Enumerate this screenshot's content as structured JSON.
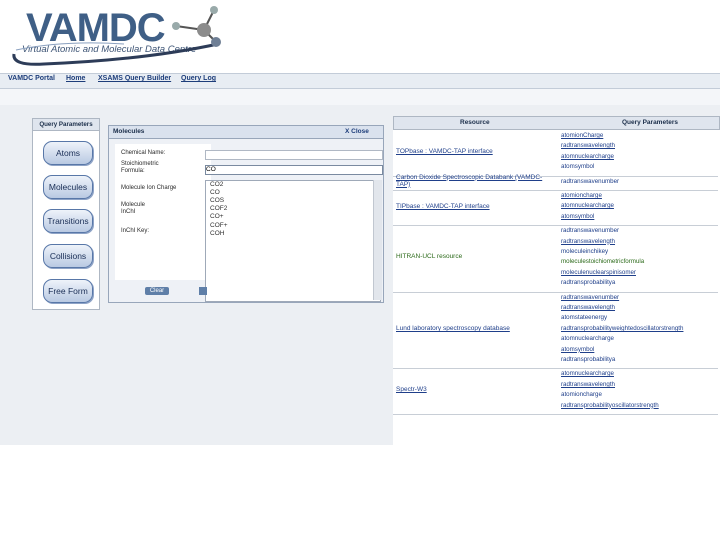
{
  "header": {
    "logo_text": "VAMDC",
    "logo_subtitle": "Virtual Atomic and Molecular Data Centre"
  },
  "nav": {
    "items": [
      {
        "label": "VAMDC Portal"
      },
      {
        "label": "Home"
      },
      {
        "label": "XSAMS Query Builder"
      },
      {
        "label": "Query Log"
      }
    ]
  },
  "query_parameters": {
    "title": "Query Parameters",
    "buttons": [
      "Atoms",
      "Molecules",
      "Transitions",
      "Collisions",
      "Free Form"
    ]
  },
  "molecules_dialog": {
    "title": "Molecules",
    "close_label": "X Close",
    "fields": [
      {
        "label": "Chemical Name:",
        "value": ""
      },
      {
        "label": "Stoichiometric Formula:",
        "value": "CO"
      },
      {
        "label": "Molecule Ion Charge",
        "value": ""
      },
      {
        "label": "Molecule InChI",
        "value": ""
      },
      {
        "label": "InChI Key:",
        "value": ""
      }
    ],
    "suggestions": [
      "CO2",
      "CO",
      "COS",
      "COF2",
      "CO+",
      "COF+",
      "COH"
    ],
    "clear_label": "Clear"
  },
  "resource_table": {
    "col_resource": "Resource",
    "col_params": "Query Parameters",
    "rows": [
      {
        "resource": "TOPbase : VAMDC-TAP interface",
        "green": false,
        "params": [
          "atomionCharge",
          "radtranswavelength",
          "atomnuclearcharge",
          "atomsymbol"
        ],
        "underline": [
          true,
          true,
          true,
          false
        ]
      },
      {
        "resource": "Carbon Dioxide Spectroscopic Databank (VAMDC-TAP)",
        "green": false,
        "params": [
          "radtranswavenumber"
        ],
        "underline": [
          false
        ]
      },
      {
        "resource": "TIPbase : VAMDC-TAP interface",
        "green": false,
        "params": [
          "atomioncharge",
          "atomnuclearcharge",
          "atomsymbol"
        ],
        "underline": [
          true,
          true,
          true
        ]
      },
      {
        "resource": "HITRAN-UCL resource",
        "green": true,
        "params": [
          "radtranswavenumber",
          "radtranswavelength",
          "moleculeinchikey",
          "moleculestoichiometricformula",
          "moleculenuclearspinisomer",
          "radtransprobabilitya"
        ],
        "underline": [
          false,
          true,
          false,
          false,
          true,
          false
        ]
      },
      {
        "resource": "Lund laboratory spectroscopy database",
        "green": false,
        "params": [
          "radtranswavenumber",
          "radtranswavelength",
          "atomstateenergy",
          "radtransprobabilityweightedoscillatorstrength",
          "atomnuclearcharge",
          "atomsymbol",
          "radtransprobabilitya"
        ],
        "underline": [
          true,
          true,
          false,
          true,
          false,
          true,
          false
        ]
      },
      {
        "resource": "Spectr-W3",
        "green": false,
        "params": [
          "atomnuclearcharge",
          "radtranswavelength",
          "atomioncharge",
          "radtransprobabilityoscillatorstrength"
        ],
        "underline": [
          true,
          true,
          false,
          true
        ]
      }
    ]
  },
  "colors": {
    "brand": "#3f5f86",
    "link": "#1f3f8a",
    "selected_green": "#2c6a1a",
    "button_blue": "#5f7fa8"
  }
}
